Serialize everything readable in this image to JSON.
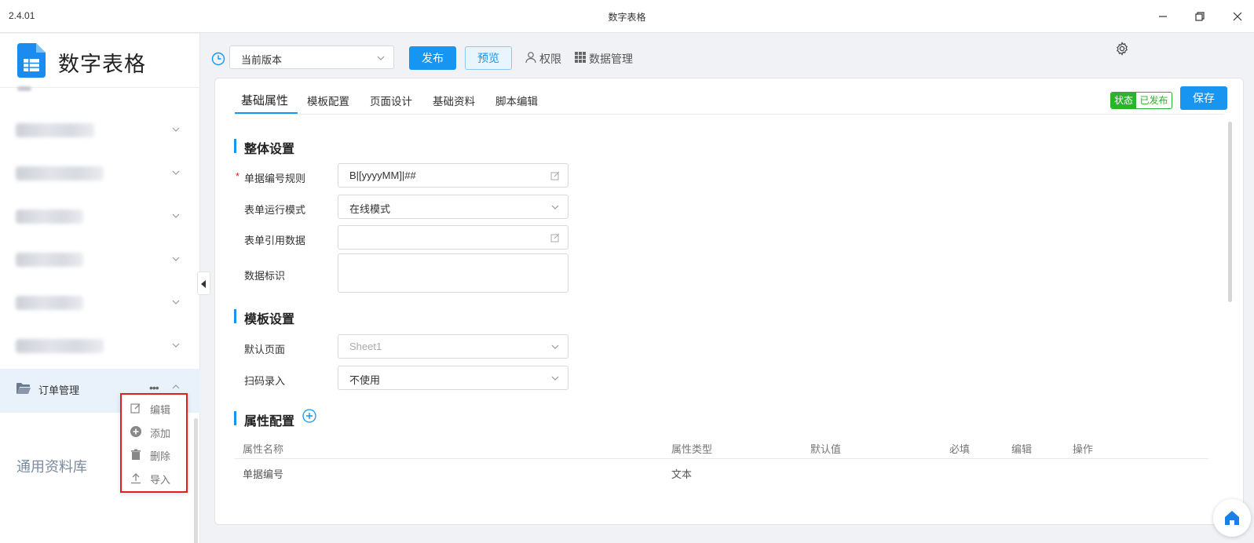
{
  "window": {
    "version": "2.4.01",
    "title": "数字表格"
  },
  "sidebar": {
    "app_name": "数字表格",
    "active_item": {
      "label": "订单管理",
      "more": "•••"
    },
    "library": "通用资料库"
  },
  "context_menu": {
    "items": [
      {
        "label": "编辑",
        "icon": "edit-icon"
      },
      {
        "label": "添加",
        "icon": "add-circle-icon"
      },
      {
        "label": "删除",
        "icon": "trash-icon"
      },
      {
        "label": "导入",
        "icon": "import-icon"
      }
    ]
  },
  "toolbar": {
    "version_select": "当前版本",
    "publish": "发布",
    "preview": "预览",
    "permissions": "权限",
    "data_management": "数据管理"
  },
  "tabs": [
    "基础属性",
    "模板配置",
    "页面设计",
    "基础资料",
    "脚本编辑"
  ],
  "status": {
    "key": "状态",
    "value": "已发布",
    "color": "#2bb32b"
  },
  "save": "保存",
  "sections": {
    "overall": "整体设置",
    "template": "模板设置",
    "attributes": "属性配置"
  },
  "form": {
    "number_rule": {
      "label": "单据编号规则",
      "value": "B|[yyyyMM]|##"
    },
    "run_mode": {
      "label": "表单运行模式",
      "value": "在线模式"
    },
    "ref_data": {
      "label": "表单引用数据",
      "value": ""
    },
    "data_tag": {
      "label": "数据标识",
      "value": ""
    },
    "default_page": {
      "label": "默认页面",
      "value": "Sheet1"
    },
    "scan_input": {
      "label": "扫码录入",
      "value": "不使用"
    }
  },
  "attr_table": {
    "columns": [
      "属性名称",
      "属性类型",
      "默认值",
      "必填",
      "编辑",
      "操作"
    ],
    "rows": [
      {
        "name": "单据编号",
        "type": "文本"
      }
    ]
  },
  "colors": {
    "accent": "#1795f0",
    "highlight_border": "#e02020"
  }
}
